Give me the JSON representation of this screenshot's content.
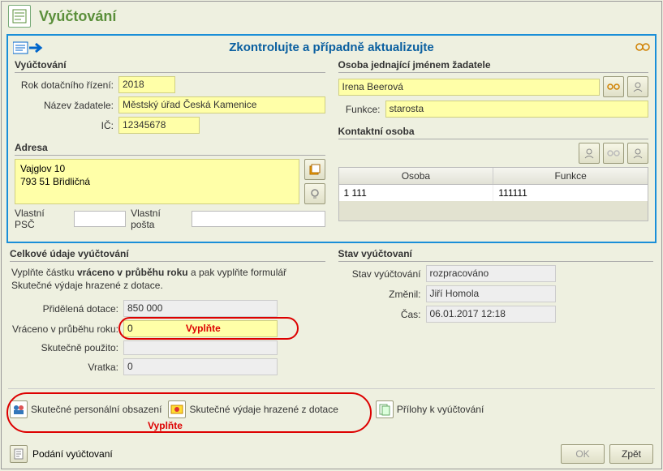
{
  "header": {
    "title": "Vyúčtování"
  },
  "blue": {
    "banner": "Zkontrolujte a případně aktualizujte"
  },
  "vyuctovani": {
    "title": "Vyúčtování",
    "rok_label": "Rok dotačního řízení:",
    "rok": "2018",
    "nazev_label": "Název žadatele:",
    "nazev": "Městský úřad Česká Kamenice",
    "ic_label": "IČ:",
    "ic": "12345678"
  },
  "adresa": {
    "title": "Adresa",
    "line1": "Vajglov 10",
    "line2": "793 51 Břidličná",
    "psc_label": "Vlastní PSČ",
    "psc": "",
    "posta_label": "Vlastní pošta",
    "posta": ""
  },
  "osoba": {
    "title": "Osoba jednající jménem žadatele",
    "name": "Irena Beerová",
    "funkce_label": "Funkce:",
    "funkce": "starosta"
  },
  "kontakt": {
    "title": "Kontaktní osoba",
    "col_osoba": "Osoba",
    "col_funkce": "Funkce",
    "rows": [
      {
        "osoba": "1 111",
        "funkce": "111111"
      }
    ]
  },
  "celkove": {
    "title": "Celkové údaje vyúčtování",
    "hint_pre": "Vyplňte částku ",
    "hint_bold": "vráceno v průběhu roku",
    "hint_post": " a pak vyplňte formulář Skutečné výdaje hrazené z dotace.",
    "pridelena_label": "Přidělená dotace:",
    "pridelena": "850 000",
    "vraceno_label": "Vráceno v průběhu roku:",
    "vraceno": "0",
    "vyplnte": "Vyplňte",
    "pouzito_label": "Skutečně použito:",
    "pouzito": "",
    "vratka_label": "Vratka:",
    "vratka": "0"
  },
  "stav": {
    "title": "Stav vyúčtovaní",
    "stav_label": "Stav vyúčtování",
    "stav": "rozpracováno",
    "zmenil_label": "Změnil:",
    "zmenil": "Jiří Homola",
    "cas_label": "Čas:",
    "cas": "06.01.2017 12:18"
  },
  "links": {
    "personal": "Skutečné personální obsazení",
    "vydaje": "Skutečné výdaje hrazené z dotace",
    "prilohy": "Přílohy k vyúčtování",
    "vyplnte": "Vyplňte"
  },
  "footer": {
    "podani": "Podání vyúčtovaní",
    "ok": "OK",
    "zpet": "Zpět"
  }
}
